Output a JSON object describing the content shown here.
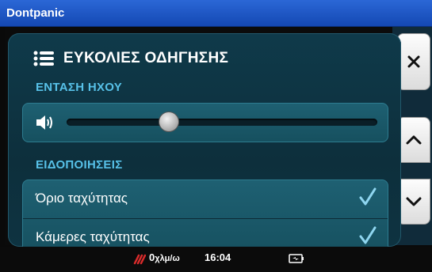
{
  "window": {
    "title": "Dontpanic"
  },
  "panel": {
    "title": "ΕΥΚΟΛΙΕΣ ΟΔΗΓΗΣΗΣ",
    "sections": {
      "volume": {
        "label": "ΕΝΤΑΣΗ ΗΧΟΥ",
        "level": 0.33
      },
      "notifications": {
        "label": "ΕΙΔΟΠΟΙΗΣΕΙΣ"
      }
    },
    "items": [
      {
        "label": "Όριο ταχύτητας",
        "checked": true
      },
      {
        "label": "Κάμερες ταχύτητας",
        "checked": true
      }
    ]
  },
  "side_buttons": [
    "close-icon",
    "chevron-up-icon",
    "chevron-down-icon"
  ],
  "status": {
    "speed_value": "0",
    "speed_unit": "χλμ/ω",
    "time": "16:04"
  },
  "colors": {
    "accent": "#57c1e8",
    "panel": "#0d2f3c",
    "titlebar": "#1f5bc8",
    "speed_icon": "#d92b2b"
  }
}
